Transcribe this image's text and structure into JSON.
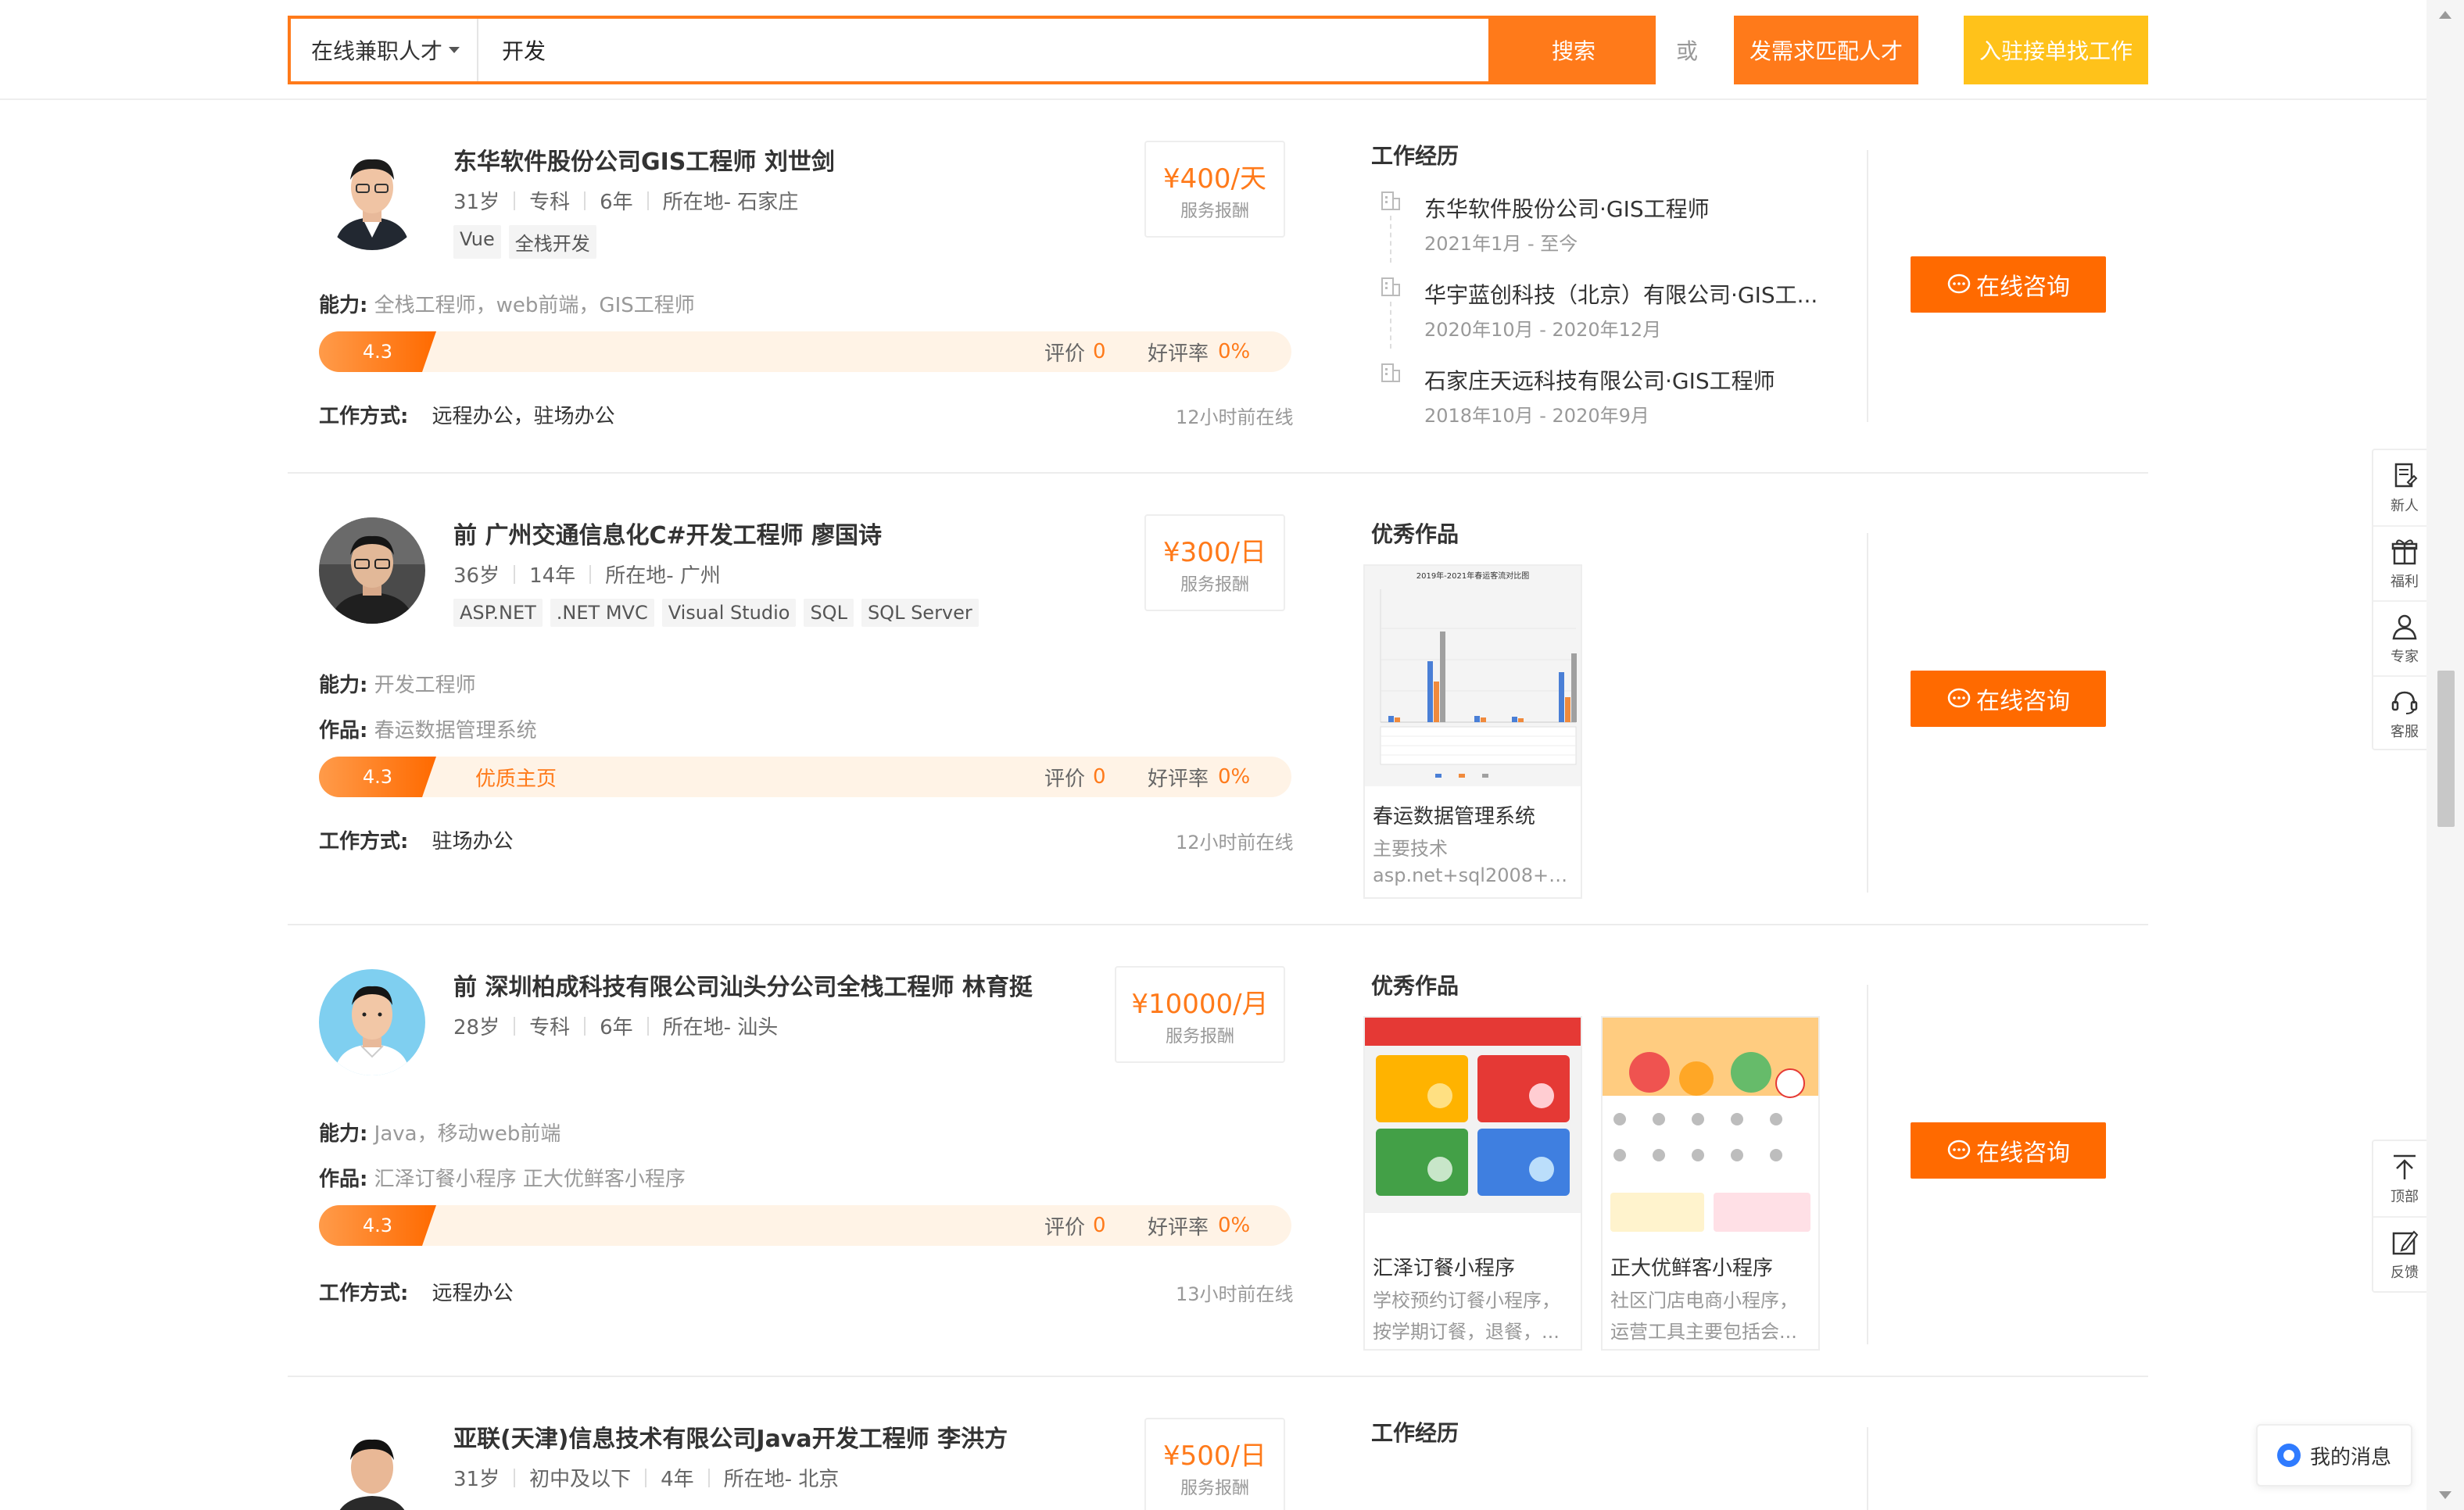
{
  "search": {
    "category": "在线兼职人才",
    "query": "开发",
    "search_label": "搜索",
    "or_text": "或",
    "post_label": "发需求匹配人才",
    "join_label": "入驻接单找工作"
  },
  "labels": {
    "ability": "能力:",
    "works": "作品:",
    "work_mode": "工作方式:",
    "price_label": "服务报酬",
    "reviews": "评价",
    "good_rate": "好评率",
    "consult": "在线咨询",
    "experience_title": "工作经历",
    "portfolio_title": "优秀作品"
  },
  "cards": [
    {
      "name": "东华软件股份公司GIS工程师 刘世剑",
      "age": "31岁",
      "education": "专科",
      "years": "6年",
      "location": "所在地- 石家庄",
      "tags": [
        "Vue",
        "全栈开发"
      ],
      "price": "¥400/天",
      "ability": "全栈工程师，web前端，GIS工程师",
      "score": "4.3",
      "reviews_count": "0",
      "good_rate": "0%",
      "work_mode": "远程办公，驻场办公",
      "online": "12小时前在线",
      "experience": [
        {
          "company": "东华软件股份公司·GIS工程师",
          "dates": "2021年1月 - 至今"
        },
        {
          "company": "华宇蓝创科技（北京）有限公司·GIS工...",
          "dates": "2020年10月 - 2020年12月"
        },
        {
          "company": "石家庄天远科技有限公司·GIS工程师",
          "dates": "2018年10月 - 2020年9月"
        }
      ]
    },
    {
      "name": "前 广州交通信息化C#开发工程师 廖国诗",
      "age": "36岁",
      "years": "14年",
      "location": "所在地- 广州",
      "tags": [
        "ASP.NET",
        ".NET MVC",
        "Visual Studio",
        "SQL",
        "SQL Server"
      ],
      "price": "¥300/日",
      "ability": "开发工程师",
      "works": "春运数据管理系统",
      "score": "4.3",
      "quality": "优质主页",
      "reviews_count": "0",
      "good_rate": "0%",
      "work_mode": "驻场办公",
      "online": "12小时前在线",
      "portfolio": [
        {
          "title": "春运数据管理系统",
          "desc1": "主要技术",
          "desc2": "asp.net+sql2008+H...",
          "thumb_title": "2019年-2021年春运客流对比图"
        }
      ]
    },
    {
      "name": "前 深圳柏成科技有限公司汕头分公司全栈工程师 林育挺",
      "age": "28岁",
      "education": "专科",
      "years": "6年",
      "location": "所在地- 汕头",
      "price": "¥10000/月",
      "ability": "Java，移动web前端",
      "works": "汇泽订餐小程序 正大优鲜客小程序",
      "score": "4.3",
      "reviews_count": "0",
      "good_rate": "0%",
      "work_mode": "远程办公",
      "online": "13小时前在线",
      "portfolio": [
        {
          "title": "汇泽订餐小程序",
          "desc1": "学校预约订餐小程序，",
          "desc2": "按学期订餐，退餐，..."
        },
        {
          "title": "正大优鲜客小程序",
          "desc1": "社区门店电商小程序，",
          "desc2": "运营工具主要包括会..."
        }
      ]
    },
    {
      "name": "亚联(天津)信息技术有限公司Java开发工程师 李洪方",
      "age": "31岁",
      "education": "初中及以下",
      "years": "4年",
      "location": "所在地- 北京",
      "price": "¥500/日"
    }
  ],
  "side_tools": [
    {
      "label": "新人",
      "icon": "note-icon"
    },
    {
      "label": "福利",
      "icon": "gift-icon"
    },
    {
      "label": "专家",
      "icon": "person-icon"
    },
    {
      "label": "客服",
      "icon": "headset-icon"
    }
  ],
  "side_tools2": [
    {
      "label": "顶部",
      "icon": "arrow-top-icon"
    },
    {
      "label": "反馈",
      "icon": "edit-icon"
    }
  ],
  "message_button": "我的消息",
  "colors": {
    "accent": "#ff7a1a",
    "consult": "#ff6a00",
    "join": "#ffc21a",
    "rating_bg": "#fff3e6"
  }
}
